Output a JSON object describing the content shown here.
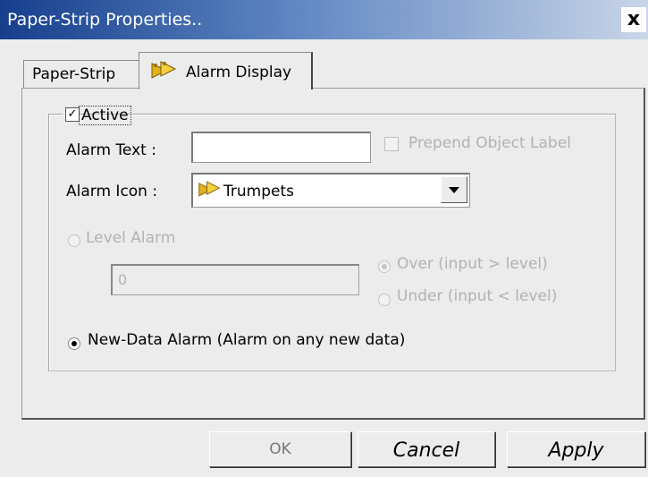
{
  "window": {
    "title": "Paper-Strip Properties..",
    "close_label": "x"
  },
  "tabs": [
    {
      "label": "Paper-Strip",
      "active": false
    },
    {
      "label": "Alarm Display",
      "active": true,
      "icon": "trumpets-icon"
    }
  ],
  "group": {
    "active_label": "Active",
    "active_checked": true
  },
  "alarm_text": {
    "label": "Alarm Text :",
    "value": ""
  },
  "prepend": {
    "label": "Prepend Object Label",
    "checked": false,
    "enabled": false
  },
  "alarm_icon": {
    "label": "Alarm Icon :",
    "selected": "Trumpets",
    "icon": "trumpets-icon"
  },
  "level_alarm": {
    "label": "Level Alarm",
    "value": "0",
    "over_label": "Over (input > level)",
    "under_label": "Under (input < level)",
    "enabled": false
  },
  "new_data_alarm": {
    "label": "New-Data Alarm (Alarm on any new data)",
    "selected": true
  },
  "buttons": {
    "ok": "OK",
    "cancel": "Cancel",
    "apply": "Apply"
  },
  "colors": {
    "title_bar_start": "#163e8c",
    "title_bar_end": "#c9d5e8",
    "dialog_bg": "#ececec",
    "disabled_text": "#b2b2b2"
  }
}
